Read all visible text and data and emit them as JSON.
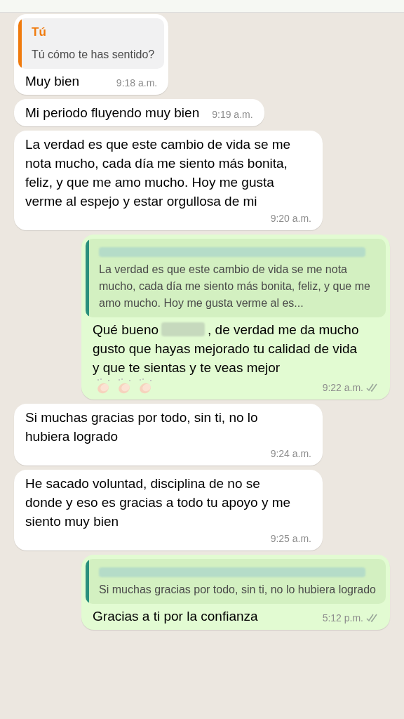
{
  "messages": [
    {
      "kind": "incoming",
      "quote": {
        "sender": "Tú",
        "text": "Tú cómo te has sentido?"
      },
      "text": "Muy bien",
      "time": "9:18 a.m."
    },
    {
      "kind": "incoming",
      "text": "Mi periodo fluyendo muy bien",
      "time": "9:19 a.m."
    },
    {
      "kind": "incoming",
      "text": "La verdad es que este cambio de vida se me nota mucho, cada día me siento más bonita, feliz, y que me amo mucho. Hoy me gusta verme al espejo y estar orgullosa de mi",
      "time": "9:20 a.m."
    },
    {
      "kind": "outgoing",
      "quote": {
        "sender_hidden": true,
        "text": "La verdad es que este cambio de vida se me nota mucho, cada día me siento más bonita, feliz, y que me amo mucho. Hoy me gusta verme al es..."
      },
      "text": "Qué bueno",
      "name_hidden": true,
      "text_after": ", de verdad me da mucho gusto que hayas mejorado tu calidad de vida y que te sientas y te veas mejor",
      "emoji": [
        {
          "kind": "clap"
        },
        {
          "kind": "clap"
        },
        {
          "kind": "clap"
        }
      ],
      "time": "9:22 a.m.",
      "read": false
    },
    {
      "kind": "incoming",
      "text": "Si muchas gracias por todo, sin ti, no lo hubiera logrado",
      "time": "9:24 a.m."
    },
    {
      "kind": "incoming",
      "text": "He sacado voluntad, disciplina de no se donde y eso es gracias a todo tu apoyo y me siento muy bien",
      "time": "9:25 a.m."
    },
    {
      "kind": "outgoing",
      "quote": {
        "sender_hidden": true,
        "text": "Si muchas gracias por todo, sin ti, no lo hubiera logrado"
      },
      "text": "Gracias a ti por la confianza",
      "time": "5:12 p.m.",
      "read": false
    }
  ]
}
